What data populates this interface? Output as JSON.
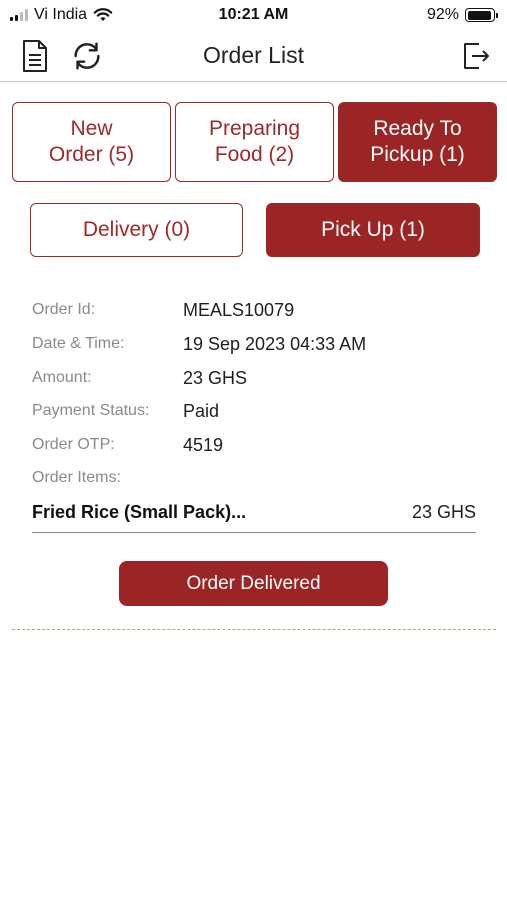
{
  "status_bar": {
    "carrier": "Vi India",
    "time": "10:21 AM",
    "battery": "92%",
    "battery_level": 0.92,
    "icons": [
      "signal-icon",
      "wifi-icon",
      "battery-icon"
    ]
  },
  "nav": {
    "title": "Order List",
    "icons": [
      "document-icon",
      "refresh-icon",
      "logout-icon"
    ]
  },
  "tabs": [
    {
      "line1": "New",
      "line2": "Order (5)",
      "active": false
    },
    {
      "line1": "Preparing",
      "line2": "Food (2)",
      "active": false
    },
    {
      "line1": "Ready To",
      "line2": "Pickup (1)",
      "active": true
    }
  ],
  "sub_tabs": [
    {
      "label": "Delivery (0)",
      "active": false
    },
    {
      "label": "Pick Up (1)",
      "active": true
    }
  ],
  "order": {
    "id_label": "Order Id:",
    "id_value": "MEALS10079",
    "datetime_label": "Date & Time:",
    "datetime_value": "19 Sep 2023 04:33 AM",
    "amount_label": "Amount:",
    "amount_value": "23 GHS",
    "payment_label": "Payment Status:",
    "payment_value": "Paid",
    "otp_label": "Order OTP:",
    "otp_value": "4519",
    "items_label": "Order Items:",
    "items": [
      {
        "name": "Fried Rice  (Small Pack)...",
        "price": "23 GHS"
      }
    ],
    "action_label": "Order Delivered"
  },
  "colors": {
    "accent": "#9b2525",
    "divider": "#b8a570"
  }
}
